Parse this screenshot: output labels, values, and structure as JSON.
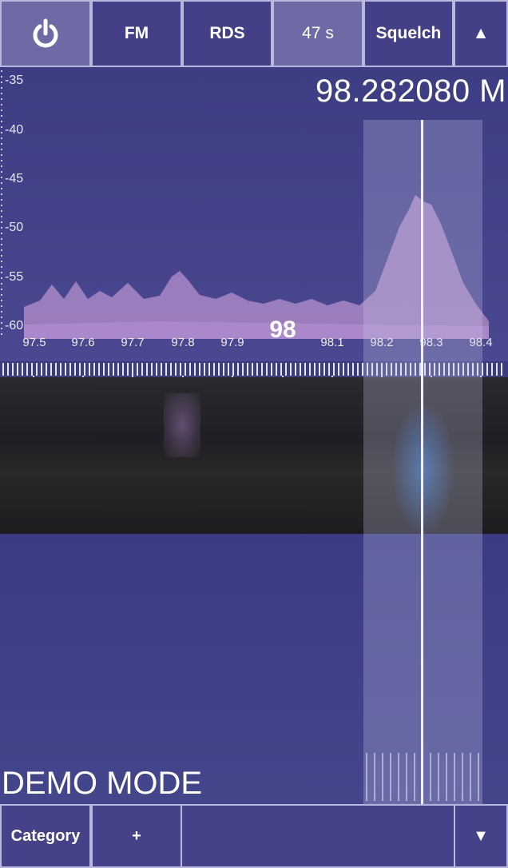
{
  "toolbar": {
    "power_icon": "power-icon",
    "mode_label": "FM",
    "rds_label": "RDS",
    "timer_label": "47 s",
    "squelch_label": "Squelch",
    "collapse_icon": "▲"
  },
  "spectrum": {
    "frequency_readout": "98.282080 M",
    "db_scale": [
      "-35",
      "-40",
      "-45",
      "-50",
      "-55",
      "-60"
    ],
    "freq_ticks": [
      "97.5",
      "97.6",
      "97.7",
      "97.8",
      "97.9",
      "98",
      "98.1",
      "98.2",
      "98.3",
      "98.4"
    ],
    "center_label": "98"
  },
  "status": {
    "demo_mode": "DEMO MODE"
  },
  "bottombar": {
    "category_label": "Category",
    "add_label": "+",
    "expand_icon": "▼"
  },
  "colors": {
    "background": "#41417e",
    "button": "#434087",
    "button_border": "#b8b8dc",
    "spectrum_fill": "#d9a6e0",
    "waterfall_signal": "#3a8cff"
  }
}
